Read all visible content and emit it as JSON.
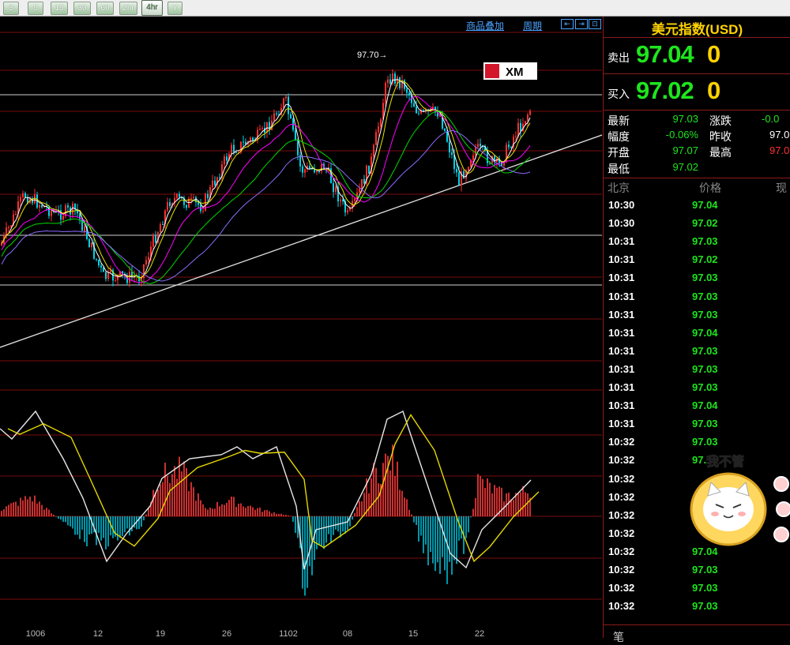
{
  "toolbar": {
    "timeframes": [
      "3",
      "5",
      "15",
      "30",
      "60",
      "2hr",
      "4hr",
      "Y"
    ],
    "active": "4hr"
  },
  "chart": {
    "links": [
      "商品叠加",
      "周期"
    ],
    "high_label": "97.70→",
    "x_labels": [
      "1006",
      "12",
      "19",
      "26",
      "1102",
      "08",
      "15",
      "22"
    ],
    "colors": {
      "up": "#ff3030",
      "down": "#00d2e6",
      "grid": "#7a0d0d",
      "ma1": "#ffffff",
      "ma2": "#e6e600",
      "ma3": "#ff00ff",
      "ma4": "#00d800",
      "ma5": "#8c6cff",
      "macd_up": "#ff3b3b",
      "macd_down": "#00bcd4"
    },
    "logo": "XM"
  },
  "panel": {
    "title": "美元指数(USD)",
    "sell_label": "卖出",
    "sell_price": "97.04",
    "sell_qty": "0",
    "buy_label": "买入",
    "buy_price": "97.02",
    "buy_qty": "0",
    "stats": [
      {
        "label": "最新",
        "value": "97.03",
        "color": "#1ee61e"
      },
      {
        "label": "涨跌",
        "value": "-0.0",
        "color": "#1ee61e"
      },
      {
        "label": "幅度",
        "value": "-0.06%",
        "color": "#1ee61e"
      },
      {
        "label": "昨收",
        "value": "97.0",
        "color": "#ffffff"
      },
      {
        "label": "开盘",
        "value": "97.07",
        "color": "#1ee61e"
      },
      {
        "label": "最高",
        "value": "97.0",
        "color": "#ff3030"
      },
      {
        "label": "最低",
        "value": "97.02",
        "color": "#1ee61e"
      }
    ],
    "tick_headers": [
      "北京",
      "价格",
      "现"
    ],
    "ticks": [
      {
        "time": "10:30",
        "price": "97.04"
      },
      {
        "time": "10:30",
        "price": "97.02"
      },
      {
        "time": "10:31",
        "price": "97.03"
      },
      {
        "time": "10:31",
        "price": "97.02"
      },
      {
        "time": "10:31",
        "price": "97.03"
      },
      {
        "time": "10:31",
        "price": "97.03"
      },
      {
        "time": "10:31",
        "price": "97.03"
      },
      {
        "time": "10:31",
        "price": "97.04"
      },
      {
        "time": "10:31",
        "price": "97.03"
      },
      {
        "time": "10:31",
        "price": "97.03"
      },
      {
        "time": "10:31",
        "price": "97.03"
      },
      {
        "time": "10:31",
        "price": "97.04"
      },
      {
        "time": "10:31",
        "price": "97.03"
      },
      {
        "time": "10:32",
        "price": "97.03"
      },
      {
        "time": "10:32",
        "price": "97."
      },
      {
        "time": "10:32",
        "price": ""
      },
      {
        "time": "10:32",
        "price": ""
      },
      {
        "time": "10:32",
        "price": ""
      },
      {
        "time": "10:32",
        "price": ""
      },
      {
        "time": "10:32",
        "price": "97.04"
      },
      {
        "time": "10:32",
        "price": "97.03"
      },
      {
        "time": "10:32",
        "price": "97.03"
      },
      {
        "time": "10:32",
        "price": "97.03"
      }
    ],
    "bottom_label": "笔"
  },
  "sticker": {
    "text": "我不管"
  }
}
